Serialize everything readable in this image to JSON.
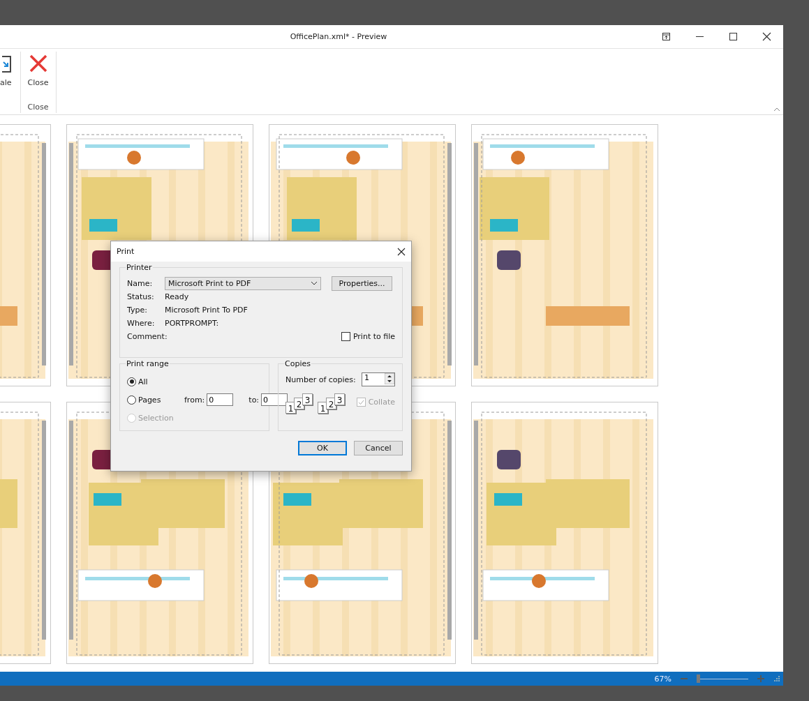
{
  "window": {
    "title": "OfficePlan.xml* - Preview"
  },
  "ribbon": {
    "partial_button": {
      "label": "ale"
    },
    "groups": [
      {
        "label": "Close",
        "buttons": [
          {
            "label": "Close"
          }
        ]
      }
    ]
  },
  "print_dialog": {
    "title": "Print",
    "printer": {
      "legend": "Printer",
      "name_label": "Name:",
      "name_value": "Microsoft Print to PDF",
      "properties_button": "Properties...",
      "info": [
        {
          "label": "Status:",
          "value": "Ready"
        },
        {
          "label": "Type:",
          "value": "Microsoft Print To PDF"
        },
        {
          "label": "Where:",
          "value": "PORTPROMPT:"
        },
        {
          "label": "Comment:"
        }
      ],
      "print_to_file": {
        "label": "Print to file",
        "checked": false
      }
    },
    "print_range": {
      "legend": "Print range",
      "options": [
        {
          "label": "All",
          "selected": true,
          "disabled": false
        },
        {
          "label": "Pages",
          "selected": false,
          "disabled": false
        },
        {
          "label": "Selection",
          "selected": false,
          "disabled": true
        }
      ],
      "from_label": "from:",
      "from_value": "0",
      "to_label": "to:",
      "to_value": "0"
    },
    "copies": {
      "legend": "Copies",
      "label": "Number of copies:",
      "value": "1",
      "collate_stacks": [
        [
          "1",
          "2",
          "3"
        ],
        [
          "1",
          "2",
          "3"
        ]
      ],
      "collate": {
        "label": "Collate",
        "checked": true,
        "disabled": true
      }
    },
    "buttons": [
      {
        "label": "OK",
        "default": true
      },
      {
        "label": "Cancel",
        "default": false
      }
    ]
  },
  "status_bar": {
    "zoom": "67%",
    "zoom_slider": {
      "level": 0.0
    }
  }
}
